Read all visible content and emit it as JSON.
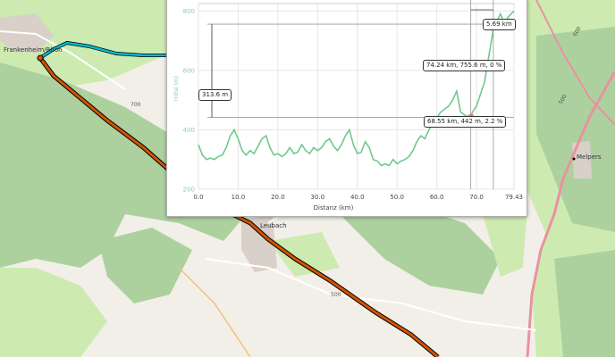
{
  "map": {
    "places": [
      "Frankenheim/Rhön",
      "Leubach",
      "Melpers"
    ],
    "road_labels": [
      "700",
      "500",
      "600",
      "500"
    ],
    "colors": {
      "background": "#f2efe9",
      "forest": "#add19e",
      "meadow": "#cdebb0",
      "route_active": "#00bcd4",
      "route_main": "#d35400",
      "route_outline": "#000000",
      "main_road": "#e892a2"
    }
  },
  "profile": {
    "axis_x_title": "Distanz (km)",
    "axis_y_title": "Höhe (m)",
    "callouts": {
      "distance_span": "5.69 km",
      "height_span": "313.6 m",
      "point_high": "74.24 km, 755.6 m, 0 %",
      "point_low": "68.55 km, 442 m, 2.2 %"
    },
    "colors": {
      "line": "#6fc98a",
      "grid": "#e6e6e6",
      "marker_high": "#4a90e2",
      "marker_low": "#e74c3c"
    }
  },
  "chart_data": {
    "type": "line",
    "xlabel": "Distanz (km)",
    "ylabel": "Höhe (m)",
    "xlim": [
      0,
      79.43
    ],
    "ylim": [
      200,
      900
    ],
    "x_ticks": [
      "0.0",
      "10.0",
      "20.0",
      "30.0",
      "40.0",
      "50.0",
      "60.0",
      "70.0",
      "79.43"
    ],
    "y_ticks": [
      "200",
      "400",
      "600",
      "800"
    ],
    "series": [
      {
        "x": [
          0,
          1,
          2,
          3,
          4,
          5,
          6,
          7,
          8,
          9,
          10,
          11,
          12,
          13,
          14,
          15,
          16,
          17,
          18,
          19,
          20,
          21,
          22,
          23,
          24,
          25,
          26,
          27,
          28,
          29,
          30,
          31,
          32,
          33,
          34,
          35,
          36,
          37,
          38,
          39,
          40,
          41,
          42,
          43,
          44,
          45,
          46,
          47,
          48,
          49,
          50,
          51,
          52,
          53,
          54,
          55,
          56,
          57,
          58,
          59,
          60,
          61,
          62,
          63,
          64,
          65,
          66,
          67,
          68,
          68.55,
          69,
          70,
          71,
          72,
          73,
          74,
          74.24,
          75,
          76,
          77,
          78,
          79.43
        ],
        "values": [
          350,
          315,
          300,
          305,
          300,
          310,
          315,
          340,
          380,
          400,
          370,
          330,
          315,
          330,
          320,
          345,
          370,
          380,
          340,
          315,
          320,
          310,
          320,
          340,
          320,
          325,
          350,
          330,
          320,
          340,
          330,
          340,
          360,
          370,
          345,
          330,
          350,
          380,
          400,
          350,
          320,
          325,
          360,
          340,
          300,
          295,
          280,
          285,
          280,
          300,
          285,
          295,
          300,
          310,
          330,
          360,
          380,
          370,
          400,
          420,
          440,
          460,
          470,
          480,
          500,
          530,
          460,
          450,
          440,
          442,
          460,
          480,
          520,
          560,
          640,
          720,
          755.6,
          760,
          790,
          760,
          780,
          800
        ]
      }
    ],
    "annotations": [
      {
        "x": 68.55,
        "y": 442,
        "label": "68.55 km, 442 m, 2.2 %"
      },
      {
        "x": 74.24,
        "y": 755.6,
        "label": "74.24 km, 755.6 m, 0 %"
      }
    ]
  }
}
